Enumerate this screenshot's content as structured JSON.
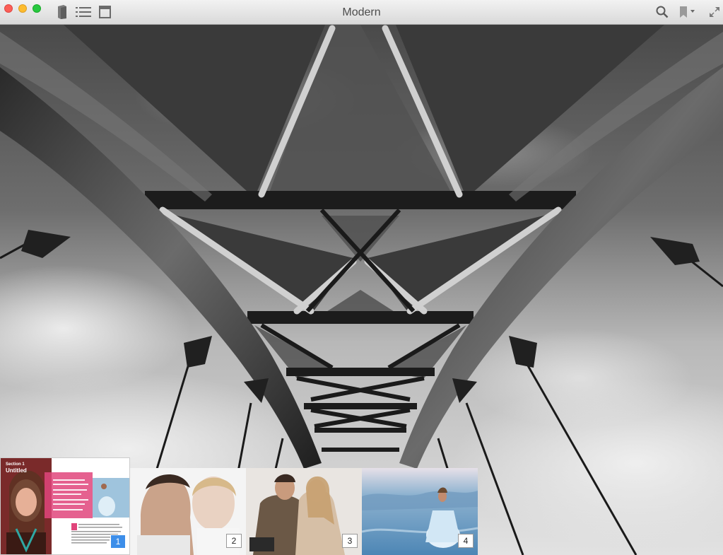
{
  "window": {
    "title": "Modern"
  },
  "toolbar": {
    "left_buttons": [
      "book-icon",
      "list-icon",
      "sidebar-icon"
    ],
    "right_buttons": [
      "search-icon",
      "bookmark-icon",
      "fullscreen-icon"
    ]
  },
  "thumbnails": {
    "page1": {
      "number": "1",
      "heading_small": "Section 1",
      "heading": "Untitled"
    },
    "page2": {
      "number": "2"
    },
    "page3": {
      "number": "3"
    },
    "page4": {
      "number": "4"
    }
  },
  "colors": {
    "accent_pink": "#e0457b",
    "selected_blue": "#3d8ee9"
  }
}
